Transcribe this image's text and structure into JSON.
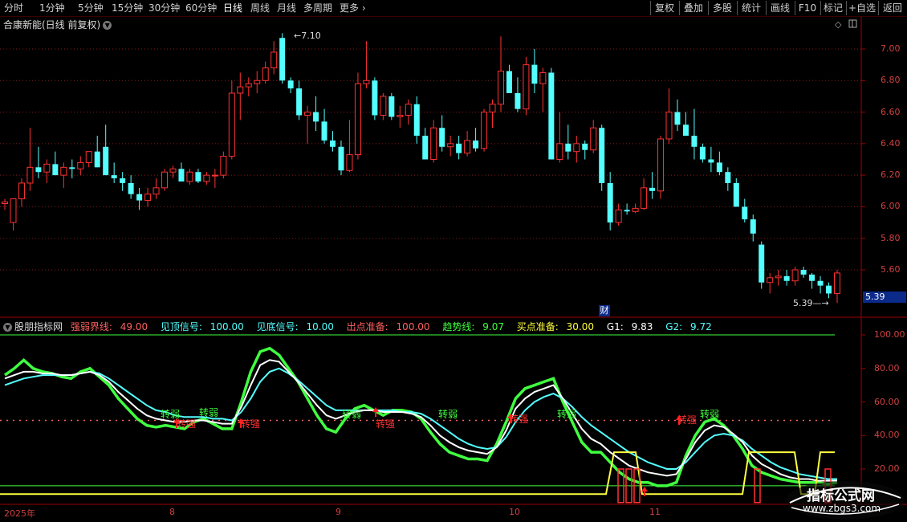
{
  "toolbar": {
    "periods": [
      "分时",
      "1分钟",
      "5分钟",
      "15分钟",
      "30分钟",
      "60分钟",
      "日线",
      "周线",
      "月线",
      "多周期",
      "更多"
    ],
    "active_period": "日线",
    "buttons": [
      "复权",
      "叠加",
      "多股",
      "统计",
      "画线",
      "F10",
      "标记",
      "+自选",
      "返回"
    ]
  },
  "main_title": "合康新能(日线 前复权)",
  "price_panel": {
    "high_marker": "7.10",
    "low_marker": "5.39",
    "current_price": "5.39",
    "event_badge": "财",
    "y_ticks": [
      "7.00",
      "6.80",
      "6.60",
      "6.40",
      "6.20",
      "6.00",
      "5.80",
      "5.60"
    ],
    "y_values": [
      7.0,
      6.8,
      6.6,
      6.4,
      6.2,
      6.0,
      5.8,
      5.6
    ],
    "up_color": "#ff3232",
    "down_color": "#54ffff"
  },
  "indicator_panel": {
    "name": "股朋指标网",
    "params": [
      {
        "label": "强弱界线:",
        "value": "49.00",
        "color": "#ff6060"
      },
      {
        "label": "见顶信号:",
        "value": "100.00",
        "color": "#54ffff"
      },
      {
        "label": "见底信号:",
        "value": "10.00",
        "color": "#54ffff"
      },
      {
        "label": "出点准备:",
        "value": "100.00",
        "color": "#ff6060"
      },
      {
        "label": "趋势线:",
        "value": "9.07",
        "color": "#40ff40"
      },
      {
        "label": "买点准备:",
        "value": "30.00",
        "color": "#ffff40"
      },
      {
        "label": "G1:",
        "value": "9.83",
        "color": "#ffffff"
      },
      {
        "label": "G2:",
        "value": "9.72",
        "color": "#54ffff"
      }
    ],
    "y_ticks": [
      "100.00",
      "80.00",
      "60.00",
      "40.00",
      "20.00"
    ],
    "y_values": [
      100,
      80,
      60,
      40,
      20
    ],
    "signal_strong": "转强",
    "signal_weak": "转弱"
  },
  "x_axis": {
    "labels": [
      "2025年",
      "8",
      "9",
      "10",
      "11"
    ]
  },
  "chart_data": {
    "type": "candlestick",
    "y_range": [
      5.39,
      7.1
    ],
    "x_labels": [
      "2025年",
      "8",
      "9",
      "10",
      "11"
    ],
    "indicator_y_range": [
      0,
      100
    ]
  },
  "watermark": {
    "line1": "指标公式网",
    "line2": "www.zbgs3.com"
  }
}
